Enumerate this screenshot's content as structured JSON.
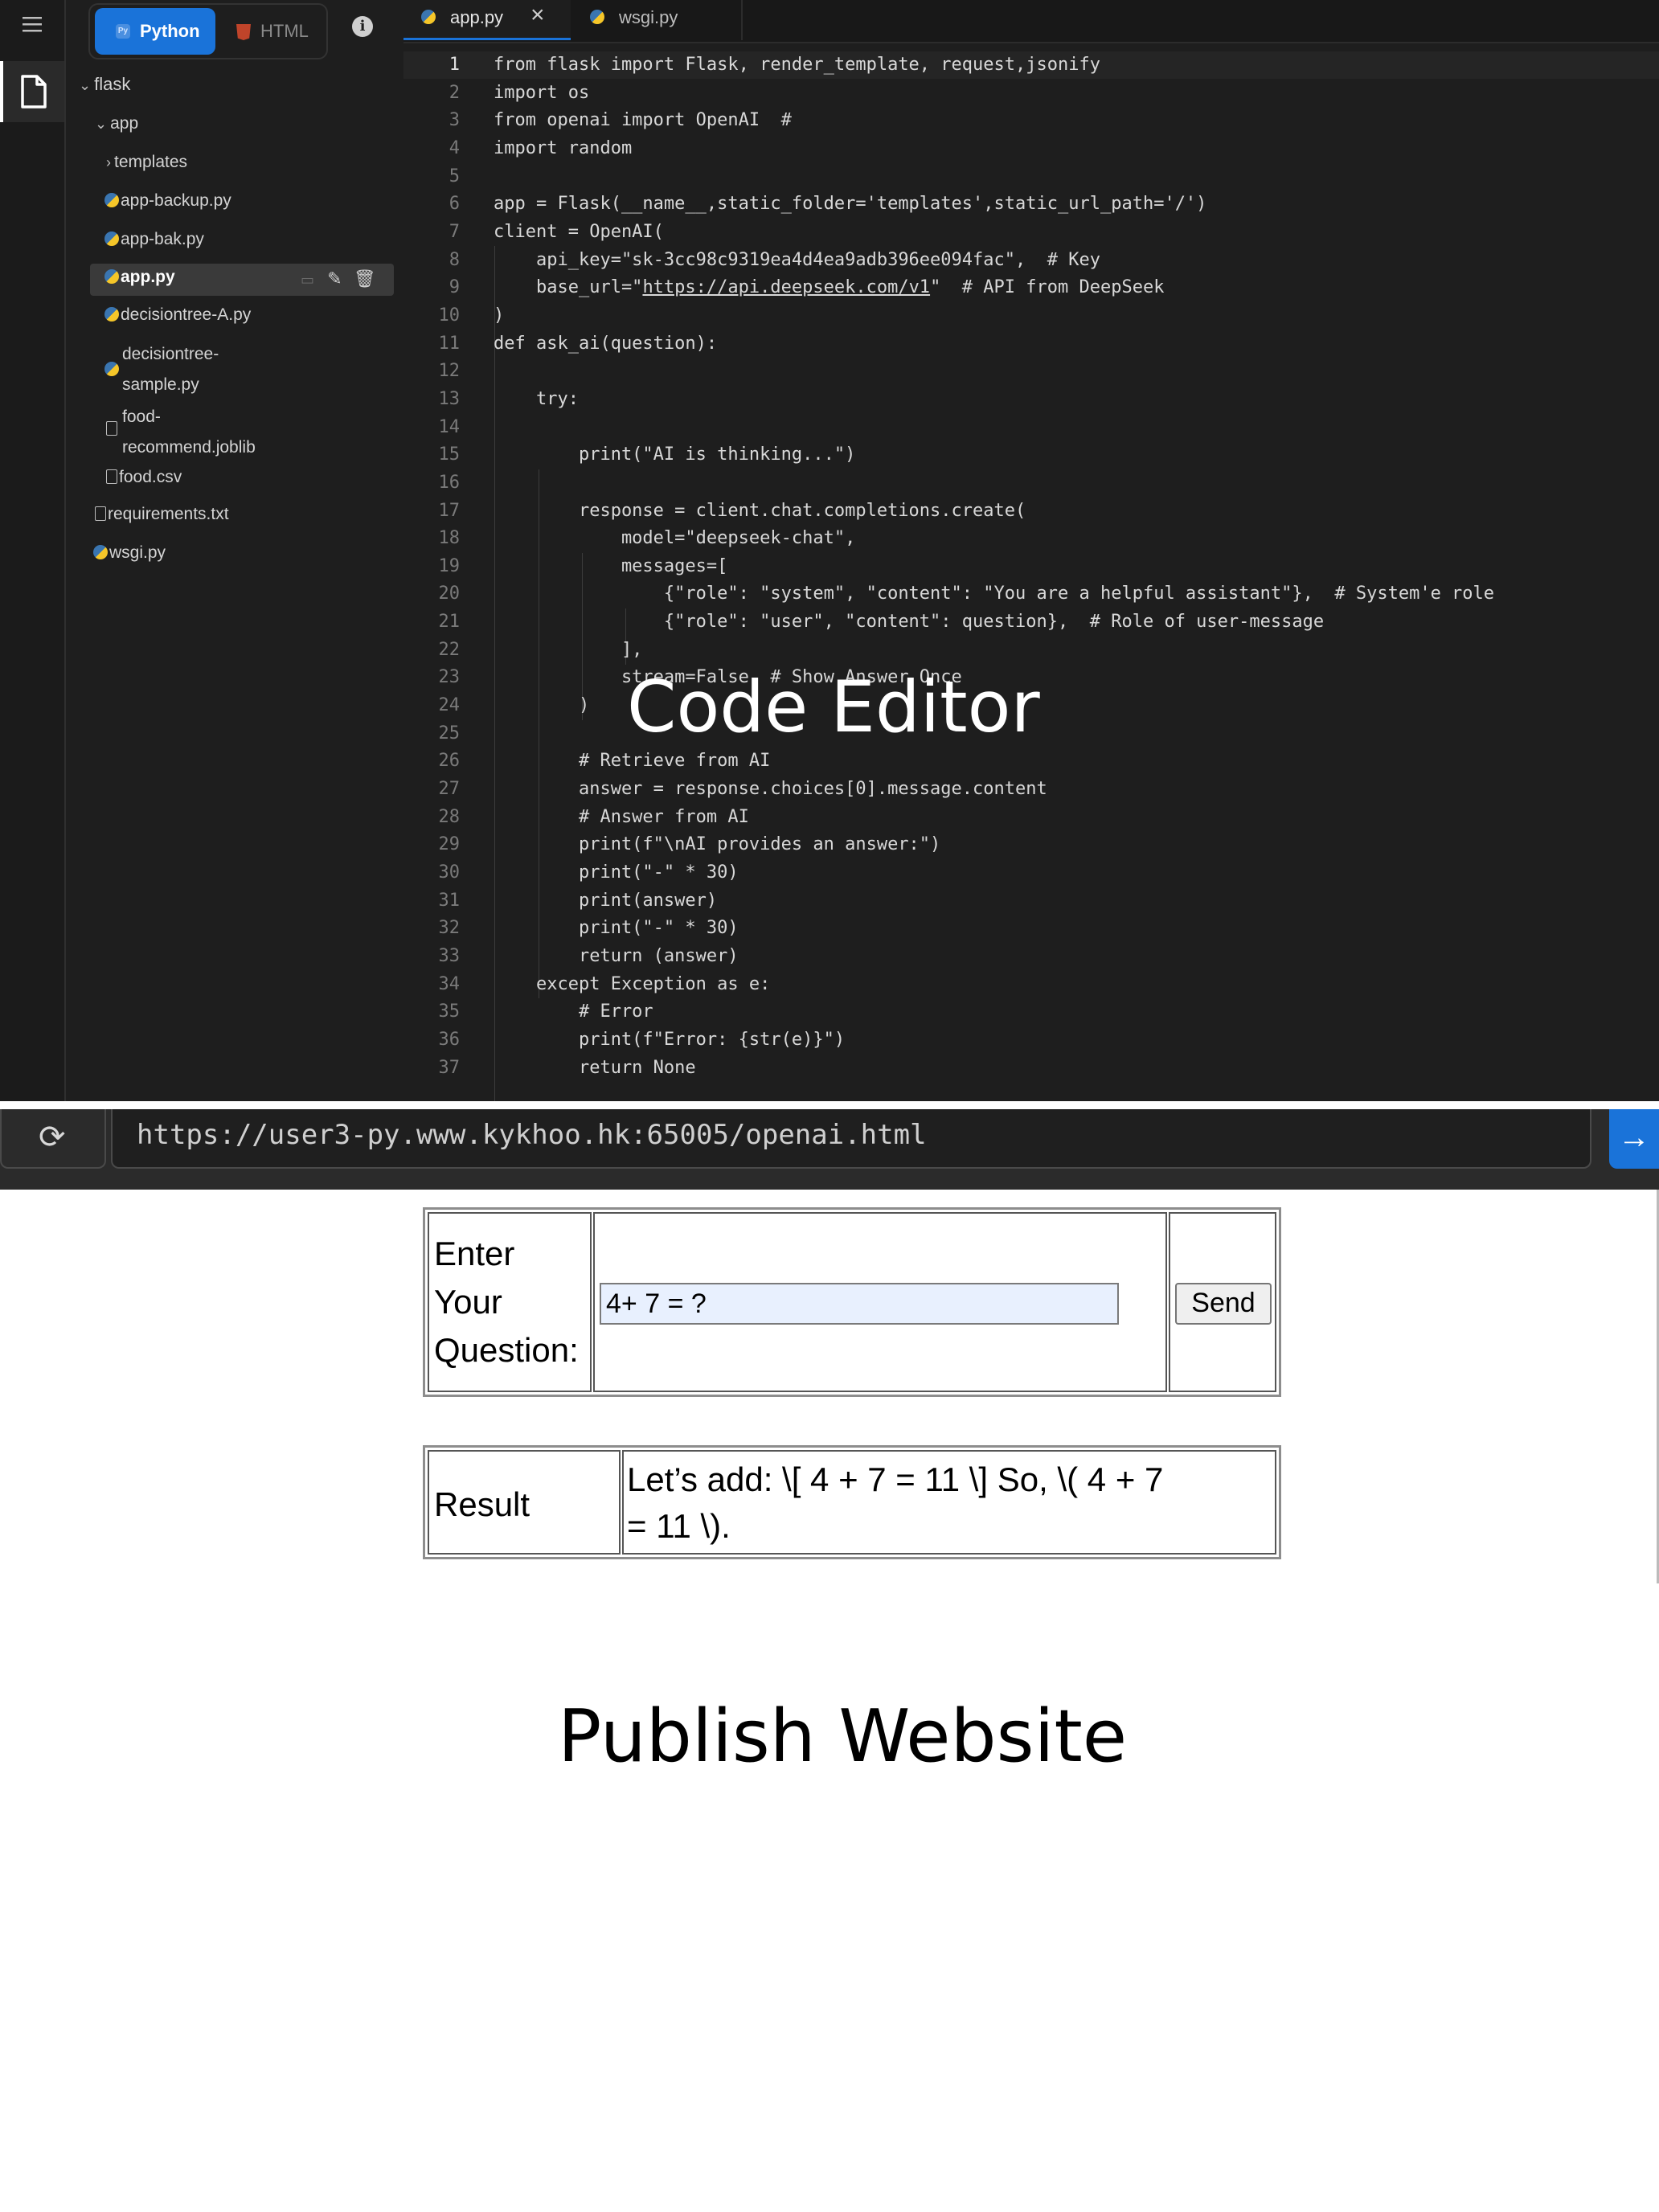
{
  "sidebar": {
    "lang_python": "Python",
    "lang_html": "HTML",
    "tree": [
      {
        "name": "flask",
        "type": "folder",
        "level": 0
      },
      {
        "name": "app",
        "type": "folder",
        "level": 1
      },
      {
        "name": "templates",
        "type": "folder-collapsed",
        "level": 2
      },
      {
        "name": "app-backup.py",
        "type": "python",
        "level": 2
      },
      {
        "name": "app-bak.py",
        "type": "python",
        "level": 2
      },
      {
        "name": "app.py",
        "type": "python",
        "level": 2,
        "selected": true
      },
      {
        "name": "decisiontree-A.py",
        "type": "python",
        "level": 2
      },
      {
        "name": "decisiontree-",
        "name2": "sample.py",
        "type": "python",
        "level": 2
      },
      {
        "name": "food-",
        "name2": "recommend.joblib",
        "type": "file",
        "level": 2
      },
      {
        "name": "food.csv",
        "type": "file",
        "level": 2
      },
      {
        "name": "requirements.txt",
        "type": "text",
        "level": 1
      },
      {
        "name": "wsgi.py",
        "type": "python",
        "level": 1
      }
    ]
  },
  "editor": {
    "tabs": [
      {
        "label": "app.py",
        "active": true
      },
      {
        "label": "wsgi.py",
        "active": false
      }
    ],
    "line_count": 37,
    "lines": [
      "from flask import Flask, render_template, request,jsonify",
      "import os",
      "from openai import OpenAI  #",
      "import random",
      "",
      "app = Flask(__name__,static_folder='templates',static_url_path='/')",
      "client = OpenAI(",
      "    api_key=\"sk-3cc98c9319ea4d4ea9adb396ee094fac\",  # Key",
      "    base_url=\"https://api.deepseek.com/v1\"  # API from DeepSeek",
      ")",
      "def ask_ai(question):",
      "",
      "    try:",
      "",
      "        print(\"AI is thinking...\")",
      "",
      "        response = client.chat.completions.create(",
      "            model=\"deepseek-chat\",",
      "            messages=[",
      "                {\"role\": \"system\", \"content\": \"You are a helpful assistant\"},  # System'e role",
      "                {\"role\": \"user\", \"content\": question},  # Role of user-message",
      "            ],",
      "            stream=False  # Show Answer Once",
      "        )",
      "",
      "        # Retrieve from AI",
      "        answer = response.choices[0].message.content",
      "        # Answer from AI",
      "        print(f\"\\nAI provides an answer:\")",
      "        print(\"-\" * 30)",
      "        print(answer)",
      "        print(\"-\" * 30)",
      "        return (answer)",
      "    except Exception as e:",
      "        # Error",
      "        print(f\"Error: {str(e)}\")",
      "        return None"
    ],
    "caption": "Code Editor"
  },
  "browser": {
    "url": "https://user3-py.www.kykhoo.hk:65005/openai.html",
    "question_label_1": "Enter",
    "question_label_2": "Your",
    "question_label_3": "Question:",
    "question_value": "4+ 7 = ?",
    "send_label": "Send",
    "result_label": "Result",
    "result_line_1": "Let’s add: \\[ 4 + 7 = 11 \\] So, \\( 4 + 7",
    "result_line_2": "= 11 \\).",
    "caption": "Publish Website"
  },
  "colors": {
    "accent": "#1a73d9",
    "editor_bg": "#1e1e1e",
    "input_bg": "#e8f0fe"
  }
}
